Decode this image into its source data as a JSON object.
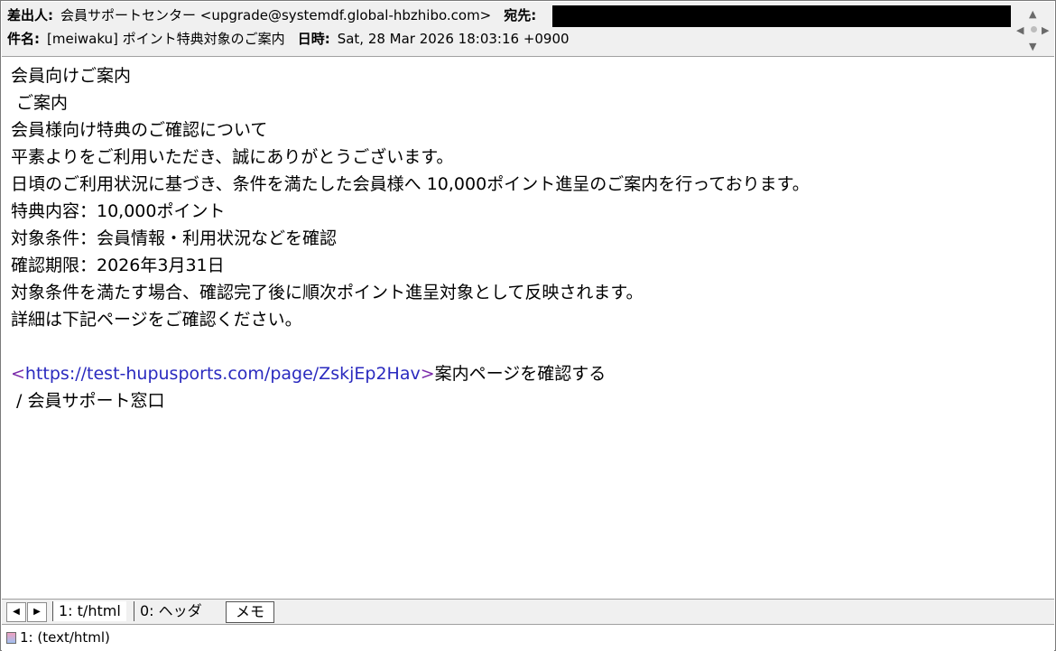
{
  "header": {
    "from_label": "差出人:",
    "from_value": "会員サポートセンター <upgrade@systemdf.global-hbzhibo.com>",
    "to_label": "宛先:",
    "subject_label": "件名:",
    "subject_value": "[meiwaku] ポイント特典対象のご案内",
    "date_label": "日時:",
    "date_value": "Sat, 28 Mar 2026 18:03:16 +0900"
  },
  "nav": {
    "up": "▲",
    "down": "▼",
    "left": "◀",
    "right": "▶"
  },
  "body": {
    "lines": [
      "会員向けご案内",
      " ご案内",
      "会員様向け特典のご確認について",
      "平素よりをご利用いただき、誠にありがとうございます。",
      "日頃のご利用状況に基づき、条件を満たした会員様へ 10,000ポイント進呈のご案内を行っております。",
      "特典内容：10,000ポイント",
      "対象条件：会員情報・利用状況などを確認",
      "確認期限：2026年3月31日",
      "対象条件を満たす場合、確認完了後に順次ポイント進呈対象として反映されます。",
      "詳細は下記ページをご確認ください。"
    ],
    "link_open": "<",
    "link_url": "https://test-hupusports.com/page/ZskjEp2Hav",
    "link_close": ">",
    "link_text": "案内ページを確認する",
    "signature": " / 会員サポート窓口"
  },
  "tabs": {
    "prev": "◀",
    "next": "▶",
    "tab1": "1: t/html",
    "tab2": "0: ヘッダ",
    "memo": "メモ"
  },
  "status": {
    "text": "1: (text/html)"
  }
}
